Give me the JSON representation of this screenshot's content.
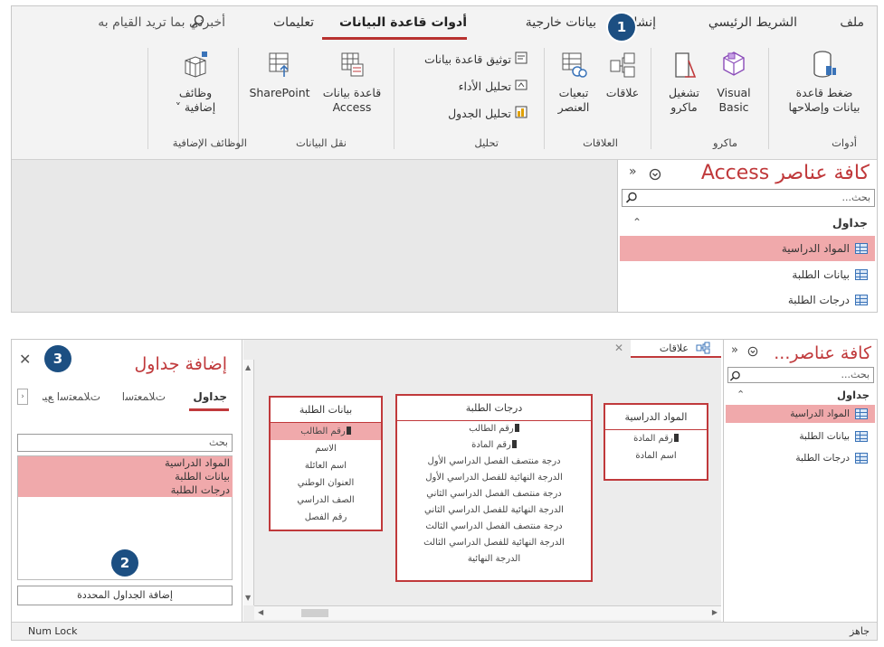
{
  "ribbon": {
    "tabs": [
      {
        "label": "ملف"
      },
      {
        "label": "الشريط الرئيسي"
      },
      {
        "label": "إنشاء"
      },
      {
        "label": "بيانات خارجية"
      },
      {
        "label": "أدوات قاعدة البيانات"
      },
      {
        "label": "تعليمات"
      }
    ],
    "tell_me": "أخبرني بما تريد القيام به",
    "groups": {
      "tools": {
        "label": "أدوات",
        "compact_repair_line1": "ضغط قاعدة",
        "compact_repair_line2": "بيانات وإصلاحها"
      },
      "macro": {
        "label": "ماكرو",
        "visual_basic_line1": "Visual",
        "visual_basic_line2": "Basic",
        "run_macro_line1": "تشغيل",
        "run_macro_line2": "ماكرو"
      },
      "relationships": {
        "label": "العلاقات",
        "relationships": "علاقات",
        "dependencies_line1": "تبعيات",
        "dependencies_line2": "العنصر"
      },
      "analyze": {
        "label": "تحليل",
        "documenter": "توثيق قاعدة بيانات",
        "performance": "تحليل الأداء",
        "table": "تحليل الجدول"
      },
      "move_data": {
        "label": "نقل البيانات",
        "access_db_line1": "قاعدة بيانات",
        "access_db_line2": "Access",
        "sharepoint": "SharePoint"
      },
      "addins": {
        "label": "الوظائف الإضافية",
        "addins_line1": "وظائف",
        "addins_line2": "إضافية ˅"
      }
    }
  },
  "nav_top": {
    "title": "كافة عناصر Access",
    "search_placeholder": "بحث...",
    "section": "جداول",
    "items": [
      "المواد الدراسية",
      "بيانات الطلبة",
      "درجات الطلبة"
    ]
  },
  "nav_bottom": {
    "title": "كافة عناصر...",
    "search_placeholder": "بحث...",
    "section": "جداول",
    "items": [
      "المواد الدراسية",
      "بيانات الطلبة",
      "درجات الطلبة"
    ]
  },
  "add_tables_pane": {
    "title": "إضافة جداول",
    "tabs": [
      "جداول",
      "ﺕﻼﻤﻌﺘﺳﺍ",
      "ﺕﻼﻤﻌﺘﺳﺍ ﻊﻴﻤﺟ"
    ],
    "search_placeholder": "بحث",
    "items": [
      "المواد الدراسية",
      "بيانات الطلبة",
      "درجات الطلبة"
    ],
    "add_button": "إضافة الجداول المحددة"
  },
  "relationships_tab": {
    "label": "علاقات"
  },
  "tables": {
    "students": {
      "title": "بيانات الطلبة",
      "fields": [
        "رقم الطالب",
        "الاسم",
        "اسم العائلة",
        "العنوان الوطني",
        "الصف الدراسي",
        "رقم الفصل"
      ]
    },
    "grades": {
      "title": "درجات الطلبة",
      "fields": [
        "رقم الطالب",
        "رقم المادة",
        "درجة منتصف الفصل الدراسي الأول",
        "الدرجة النهائية للفصل الدراسي الأول",
        "درجة منتصف الفصل الدراسي الثاني",
        "الدرجة النهائية للفصل الدراسي الثاني",
        "درجة منتصف الفصل الدراسي الثالث",
        "الدرجة النهائية للفصل الدراسي الثالث",
        "الدرجة النهائية"
      ]
    },
    "subjects": {
      "title": "المواد الدراسية",
      "fields": [
        "رقم المادة",
        "اسم المادة"
      ]
    }
  },
  "status": {
    "ready": "جاهز",
    "num_lock": "Num Lock"
  },
  "badges": {
    "one": "1",
    "two": "2",
    "three": "3"
  },
  "colors": {
    "accent": "#c0393b",
    "selection": "#f0a9ab",
    "badge": "#1c4f82"
  }
}
